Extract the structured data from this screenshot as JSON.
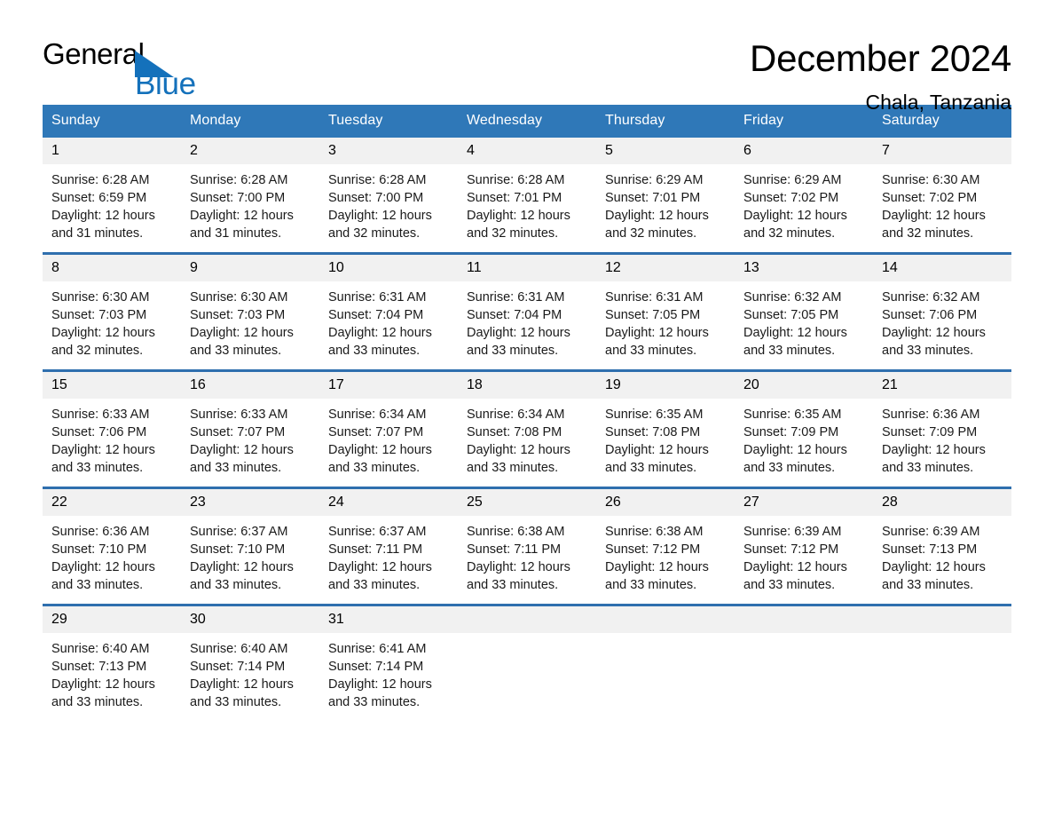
{
  "logo": {
    "word_one": "General",
    "word_two": "Blue",
    "triangle_icon": "triangle-icon"
  },
  "header": {
    "title": "December 2024",
    "subtitle": "Chala, Tanzania"
  },
  "colors": {
    "header_blue": "#2f78b8",
    "row_rule_blue": "#2f6fae",
    "day_number_bg": "#f1f1f1",
    "logo_blue": "#1471bb",
    "text": "#000000"
  },
  "weekdays": [
    "Sunday",
    "Monday",
    "Tuesday",
    "Wednesday",
    "Thursday",
    "Friday",
    "Saturday"
  ],
  "weeks": [
    [
      {
        "day": "1",
        "sunrise": "Sunrise: 6:28 AM",
        "sunset": "Sunset: 6:59 PM",
        "daylight_1": "Daylight: 12 hours",
        "daylight_2": "and 31 minutes."
      },
      {
        "day": "2",
        "sunrise": "Sunrise: 6:28 AM",
        "sunset": "Sunset: 7:00 PM",
        "daylight_1": "Daylight: 12 hours",
        "daylight_2": "and 31 minutes."
      },
      {
        "day": "3",
        "sunrise": "Sunrise: 6:28 AM",
        "sunset": "Sunset: 7:00 PM",
        "daylight_1": "Daylight: 12 hours",
        "daylight_2": "and 32 minutes."
      },
      {
        "day": "4",
        "sunrise": "Sunrise: 6:28 AM",
        "sunset": "Sunset: 7:01 PM",
        "daylight_1": "Daylight: 12 hours",
        "daylight_2": "and 32 minutes."
      },
      {
        "day": "5",
        "sunrise": "Sunrise: 6:29 AM",
        "sunset": "Sunset: 7:01 PM",
        "daylight_1": "Daylight: 12 hours",
        "daylight_2": "and 32 minutes."
      },
      {
        "day": "6",
        "sunrise": "Sunrise: 6:29 AM",
        "sunset": "Sunset: 7:02 PM",
        "daylight_1": "Daylight: 12 hours",
        "daylight_2": "and 32 minutes."
      },
      {
        "day": "7",
        "sunrise": "Sunrise: 6:30 AM",
        "sunset": "Sunset: 7:02 PM",
        "daylight_1": "Daylight: 12 hours",
        "daylight_2": "and 32 minutes."
      }
    ],
    [
      {
        "day": "8",
        "sunrise": "Sunrise: 6:30 AM",
        "sunset": "Sunset: 7:03 PM",
        "daylight_1": "Daylight: 12 hours",
        "daylight_2": "and 32 minutes."
      },
      {
        "day": "9",
        "sunrise": "Sunrise: 6:30 AM",
        "sunset": "Sunset: 7:03 PM",
        "daylight_1": "Daylight: 12 hours",
        "daylight_2": "and 33 minutes."
      },
      {
        "day": "10",
        "sunrise": "Sunrise: 6:31 AM",
        "sunset": "Sunset: 7:04 PM",
        "daylight_1": "Daylight: 12 hours",
        "daylight_2": "and 33 minutes."
      },
      {
        "day": "11",
        "sunrise": "Sunrise: 6:31 AM",
        "sunset": "Sunset: 7:04 PM",
        "daylight_1": "Daylight: 12 hours",
        "daylight_2": "and 33 minutes."
      },
      {
        "day": "12",
        "sunrise": "Sunrise: 6:31 AM",
        "sunset": "Sunset: 7:05 PM",
        "daylight_1": "Daylight: 12 hours",
        "daylight_2": "and 33 minutes."
      },
      {
        "day": "13",
        "sunrise": "Sunrise: 6:32 AM",
        "sunset": "Sunset: 7:05 PM",
        "daylight_1": "Daylight: 12 hours",
        "daylight_2": "and 33 minutes."
      },
      {
        "day": "14",
        "sunrise": "Sunrise: 6:32 AM",
        "sunset": "Sunset: 7:06 PM",
        "daylight_1": "Daylight: 12 hours",
        "daylight_2": "and 33 minutes."
      }
    ],
    [
      {
        "day": "15",
        "sunrise": "Sunrise: 6:33 AM",
        "sunset": "Sunset: 7:06 PM",
        "daylight_1": "Daylight: 12 hours",
        "daylight_2": "and 33 minutes."
      },
      {
        "day": "16",
        "sunrise": "Sunrise: 6:33 AM",
        "sunset": "Sunset: 7:07 PM",
        "daylight_1": "Daylight: 12 hours",
        "daylight_2": "and 33 minutes."
      },
      {
        "day": "17",
        "sunrise": "Sunrise: 6:34 AM",
        "sunset": "Sunset: 7:07 PM",
        "daylight_1": "Daylight: 12 hours",
        "daylight_2": "and 33 minutes."
      },
      {
        "day": "18",
        "sunrise": "Sunrise: 6:34 AM",
        "sunset": "Sunset: 7:08 PM",
        "daylight_1": "Daylight: 12 hours",
        "daylight_2": "and 33 minutes."
      },
      {
        "day": "19",
        "sunrise": "Sunrise: 6:35 AM",
        "sunset": "Sunset: 7:08 PM",
        "daylight_1": "Daylight: 12 hours",
        "daylight_2": "and 33 minutes."
      },
      {
        "day": "20",
        "sunrise": "Sunrise: 6:35 AM",
        "sunset": "Sunset: 7:09 PM",
        "daylight_1": "Daylight: 12 hours",
        "daylight_2": "and 33 minutes."
      },
      {
        "day": "21",
        "sunrise": "Sunrise: 6:36 AM",
        "sunset": "Sunset: 7:09 PM",
        "daylight_1": "Daylight: 12 hours",
        "daylight_2": "and 33 minutes."
      }
    ],
    [
      {
        "day": "22",
        "sunrise": "Sunrise: 6:36 AM",
        "sunset": "Sunset: 7:10 PM",
        "daylight_1": "Daylight: 12 hours",
        "daylight_2": "and 33 minutes."
      },
      {
        "day": "23",
        "sunrise": "Sunrise: 6:37 AM",
        "sunset": "Sunset: 7:10 PM",
        "daylight_1": "Daylight: 12 hours",
        "daylight_2": "and 33 minutes."
      },
      {
        "day": "24",
        "sunrise": "Sunrise: 6:37 AM",
        "sunset": "Sunset: 7:11 PM",
        "daylight_1": "Daylight: 12 hours",
        "daylight_2": "and 33 minutes."
      },
      {
        "day": "25",
        "sunrise": "Sunrise: 6:38 AM",
        "sunset": "Sunset: 7:11 PM",
        "daylight_1": "Daylight: 12 hours",
        "daylight_2": "and 33 minutes."
      },
      {
        "day": "26",
        "sunrise": "Sunrise: 6:38 AM",
        "sunset": "Sunset: 7:12 PM",
        "daylight_1": "Daylight: 12 hours",
        "daylight_2": "and 33 minutes."
      },
      {
        "day": "27",
        "sunrise": "Sunrise: 6:39 AM",
        "sunset": "Sunset: 7:12 PM",
        "daylight_1": "Daylight: 12 hours",
        "daylight_2": "and 33 minutes."
      },
      {
        "day": "28",
        "sunrise": "Sunrise: 6:39 AM",
        "sunset": "Sunset: 7:13 PM",
        "daylight_1": "Daylight: 12 hours",
        "daylight_2": "and 33 minutes."
      }
    ],
    [
      {
        "day": "29",
        "sunrise": "Sunrise: 6:40 AM",
        "sunset": "Sunset: 7:13 PM",
        "daylight_1": "Daylight: 12 hours",
        "daylight_2": "and 33 minutes."
      },
      {
        "day": "30",
        "sunrise": "Sunrise: 6:40 AM",
        "sunset": "Sunset: 7:14 PM",
        "daylight_1": "Daylight: 12 hours",
        "daylight_2": "and 33 minutes."
      },
      {
        "day": "31",
        "sunrise": "Sunrise: 6:41 AM",
        "sunset": "Sunset: 7:14 PM",
        "daylight_1": "Daylight: 12 hours",
        "daylight_2": "and 33 minutes."
      },
      {
        "day": "",
        "sunrise": "",
        "sunset": "",
        "daylight_1": "",
        "daylight_2": ""
      },
      {
        "day": "",
        "sunrise": "",
        "sunset": "",
        "daylight_1": "",
        "daylight_2": ""
      },
      {
        "day": "",
        "sunrise": "",
        "sunset": "",
        "daylight_1": "",
        "daylight_2": ""
      },
      {
        "day": "",
        "sunrise": "",
        "sunset": "",
        "daylight_1": "",
        "daylight_2": ""
      }
    ]
  ]
}
